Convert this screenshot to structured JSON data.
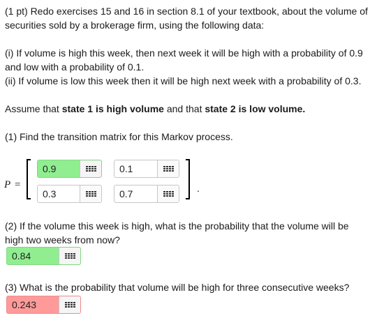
{
  "problem": {
    "intro": "(1 pt) Redo exercises 15 and 16 in section 8.1 of your textbook, about the volume of securities sold by a brokerage firm, using the following data:",
    "item_i": "(i) If volume is high this week, then next week it will be high with a probability of 0.9 and low with a probability of 0.1.",
    "item_ii": "(ii) If volume is low this week then it will be high next week with a probability of 0.3.",
    "assume_prefix": "Assume that ",
    "assume_state1": "state 1 is high volume",
    "assume_middle": " and that ",
    "assume_state2": "state 2 is low volume.",
    "q1": "(1) Find the transition matrix for this Markov process.",
    "p_symbol": "P",
    "equals": "=",
    "period": ".",
    "q2": "(2) If the volume this week is high, what is the probability that the volume will be high two weeks from now?",
    "q3": "(3) What is the probability that volume will be high for three consecutive weeks?"
  },
  "answers": {
    "m11": {
      "value": "0.9",
      "status": "correct"
    },
    "m12": {
      "value": "0.1",
      "status": "neutral"
    },
    "m21": {
      "value": "0.3",
      "status": "neutral"
    },
    "m22": {
      "value": "0.7",
      "status": "neutral"
    },
    "a2": {
      "value": "0.84",
      "status": "correct"
    },
    "a3": {
      "value": "0.243",
      "status": "incorrect"
    }
  },
  "icons": {
    "keyboard": "equation-editor-grid-icon"
  },
  "colors": {
    "correct": "#90ee90",
    "incorrect": "#ff9a9a"
  }
}
